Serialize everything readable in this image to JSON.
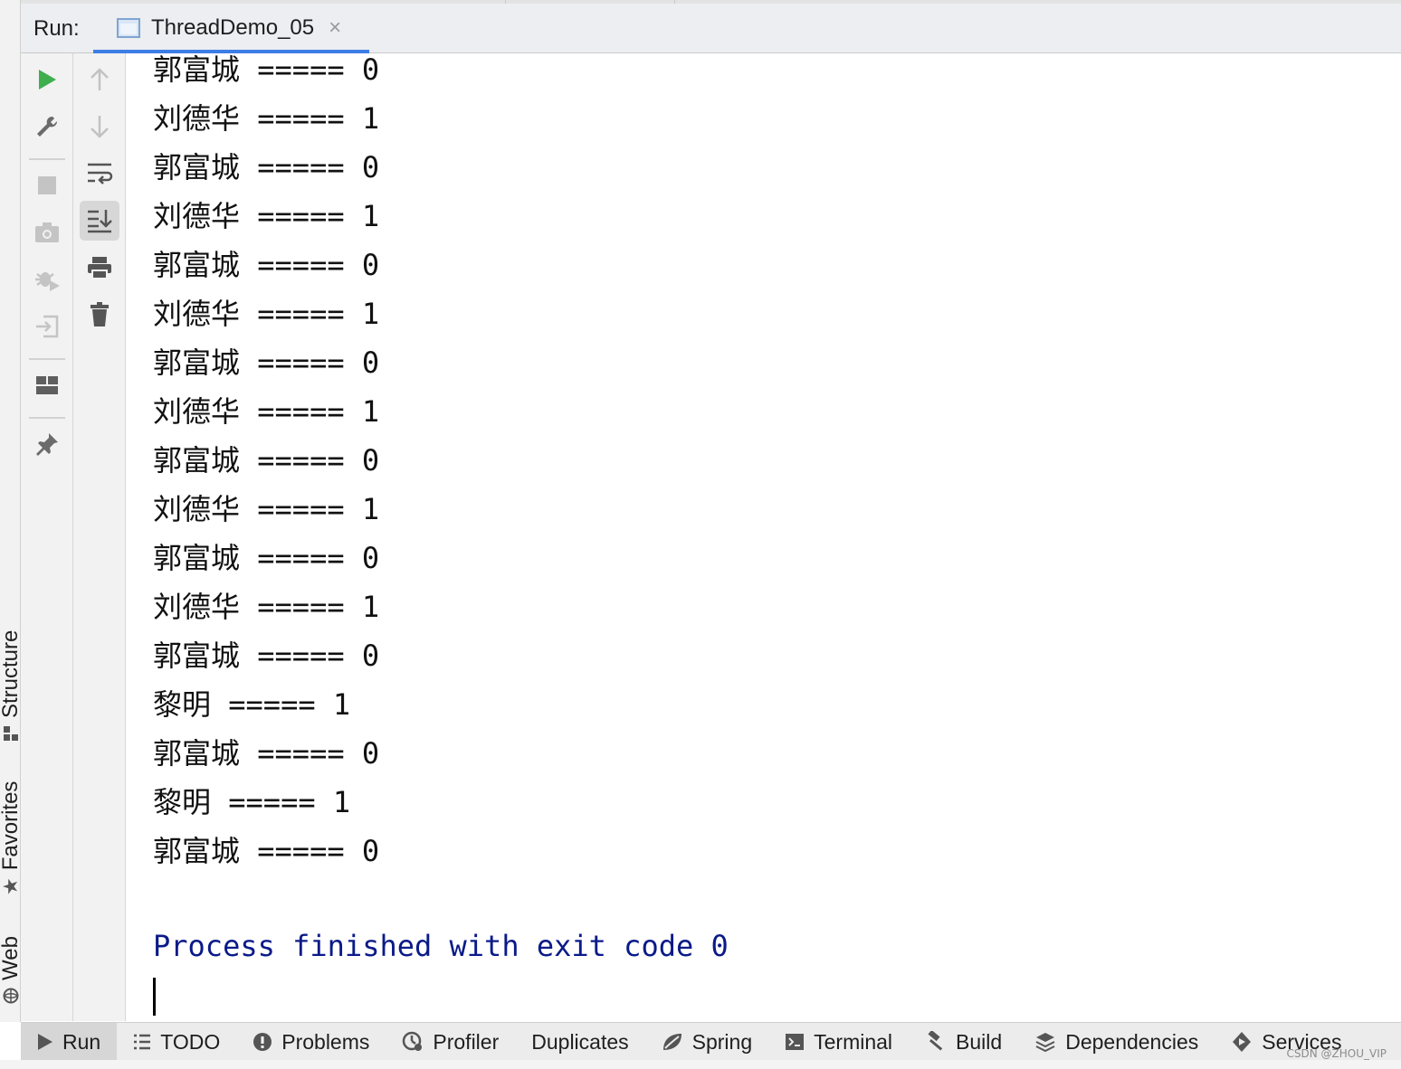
{
  "header": {
    "run_label": "Run:",
    "tab_title": "ThreadDemo_05",
    "tab_close": "×"
  },
  "side_tabs": {
    "structure": "Structure",
    "favorites": "Favorites",
    "web": "Web"
  },
  "toolbar_left": [
    "rerun-icon",
    "wrench-icon",
    "stop-icon",
    "camera-icon",
    "debug-icon",
    "exit-icon",
    "layout-icon",
    "pin-icon"
  ],
  "toolbar_right": [
    "arrow-up-icon",
    "arrow-down-icon",
    "soft-wrap-icon",
    "scroll-to-end-icon",
    "print-icon",
    "trash-icon"
  ],
  "console": {
    "lines": [
      "郭富城 ===== 0",
      "刘德华 ===== 1",
      "郭富城 ===== 0",
      "刘德华 ===== 1",
      "郭富城 ===== 0",
      "刘德华 ===== 1",
      "郭富城 ===== 0",
      "刘德华 ===== 1",
      "郭富城 ===== 0",
      "刘德华 ===== 1",
      "郭富城 ===== 0",
      "刘德华 ===== 1",
      "郭富城 ===== 0",
      "黎明 ===== 1",
      "郭富城 ===== 0",
      "黎明 ===== 1",
      "郭富城 ===== 0"
    ],
    "process_message": "Process finished with exit code 0"
  },
  "bottom_bar": {
    "run": "Run",
    "todo": "TODO",
    "problems": "Problems",
    "profiler": "Profiler",
    "duplicates": "Duplicates",
    "spring": "Spring",
    "terminal": "Terminal",
    "build": "Build",
    "dependencies": "Dependencies",
    "services": "Services"
  },
  "watermark": "CSDN @ZHOU_VIP",
  "colors": {
    "accent": "#3d7ee6",
    "run_green": "#3fae4e",
    "process_text": "#0a1a88"
  }
}
